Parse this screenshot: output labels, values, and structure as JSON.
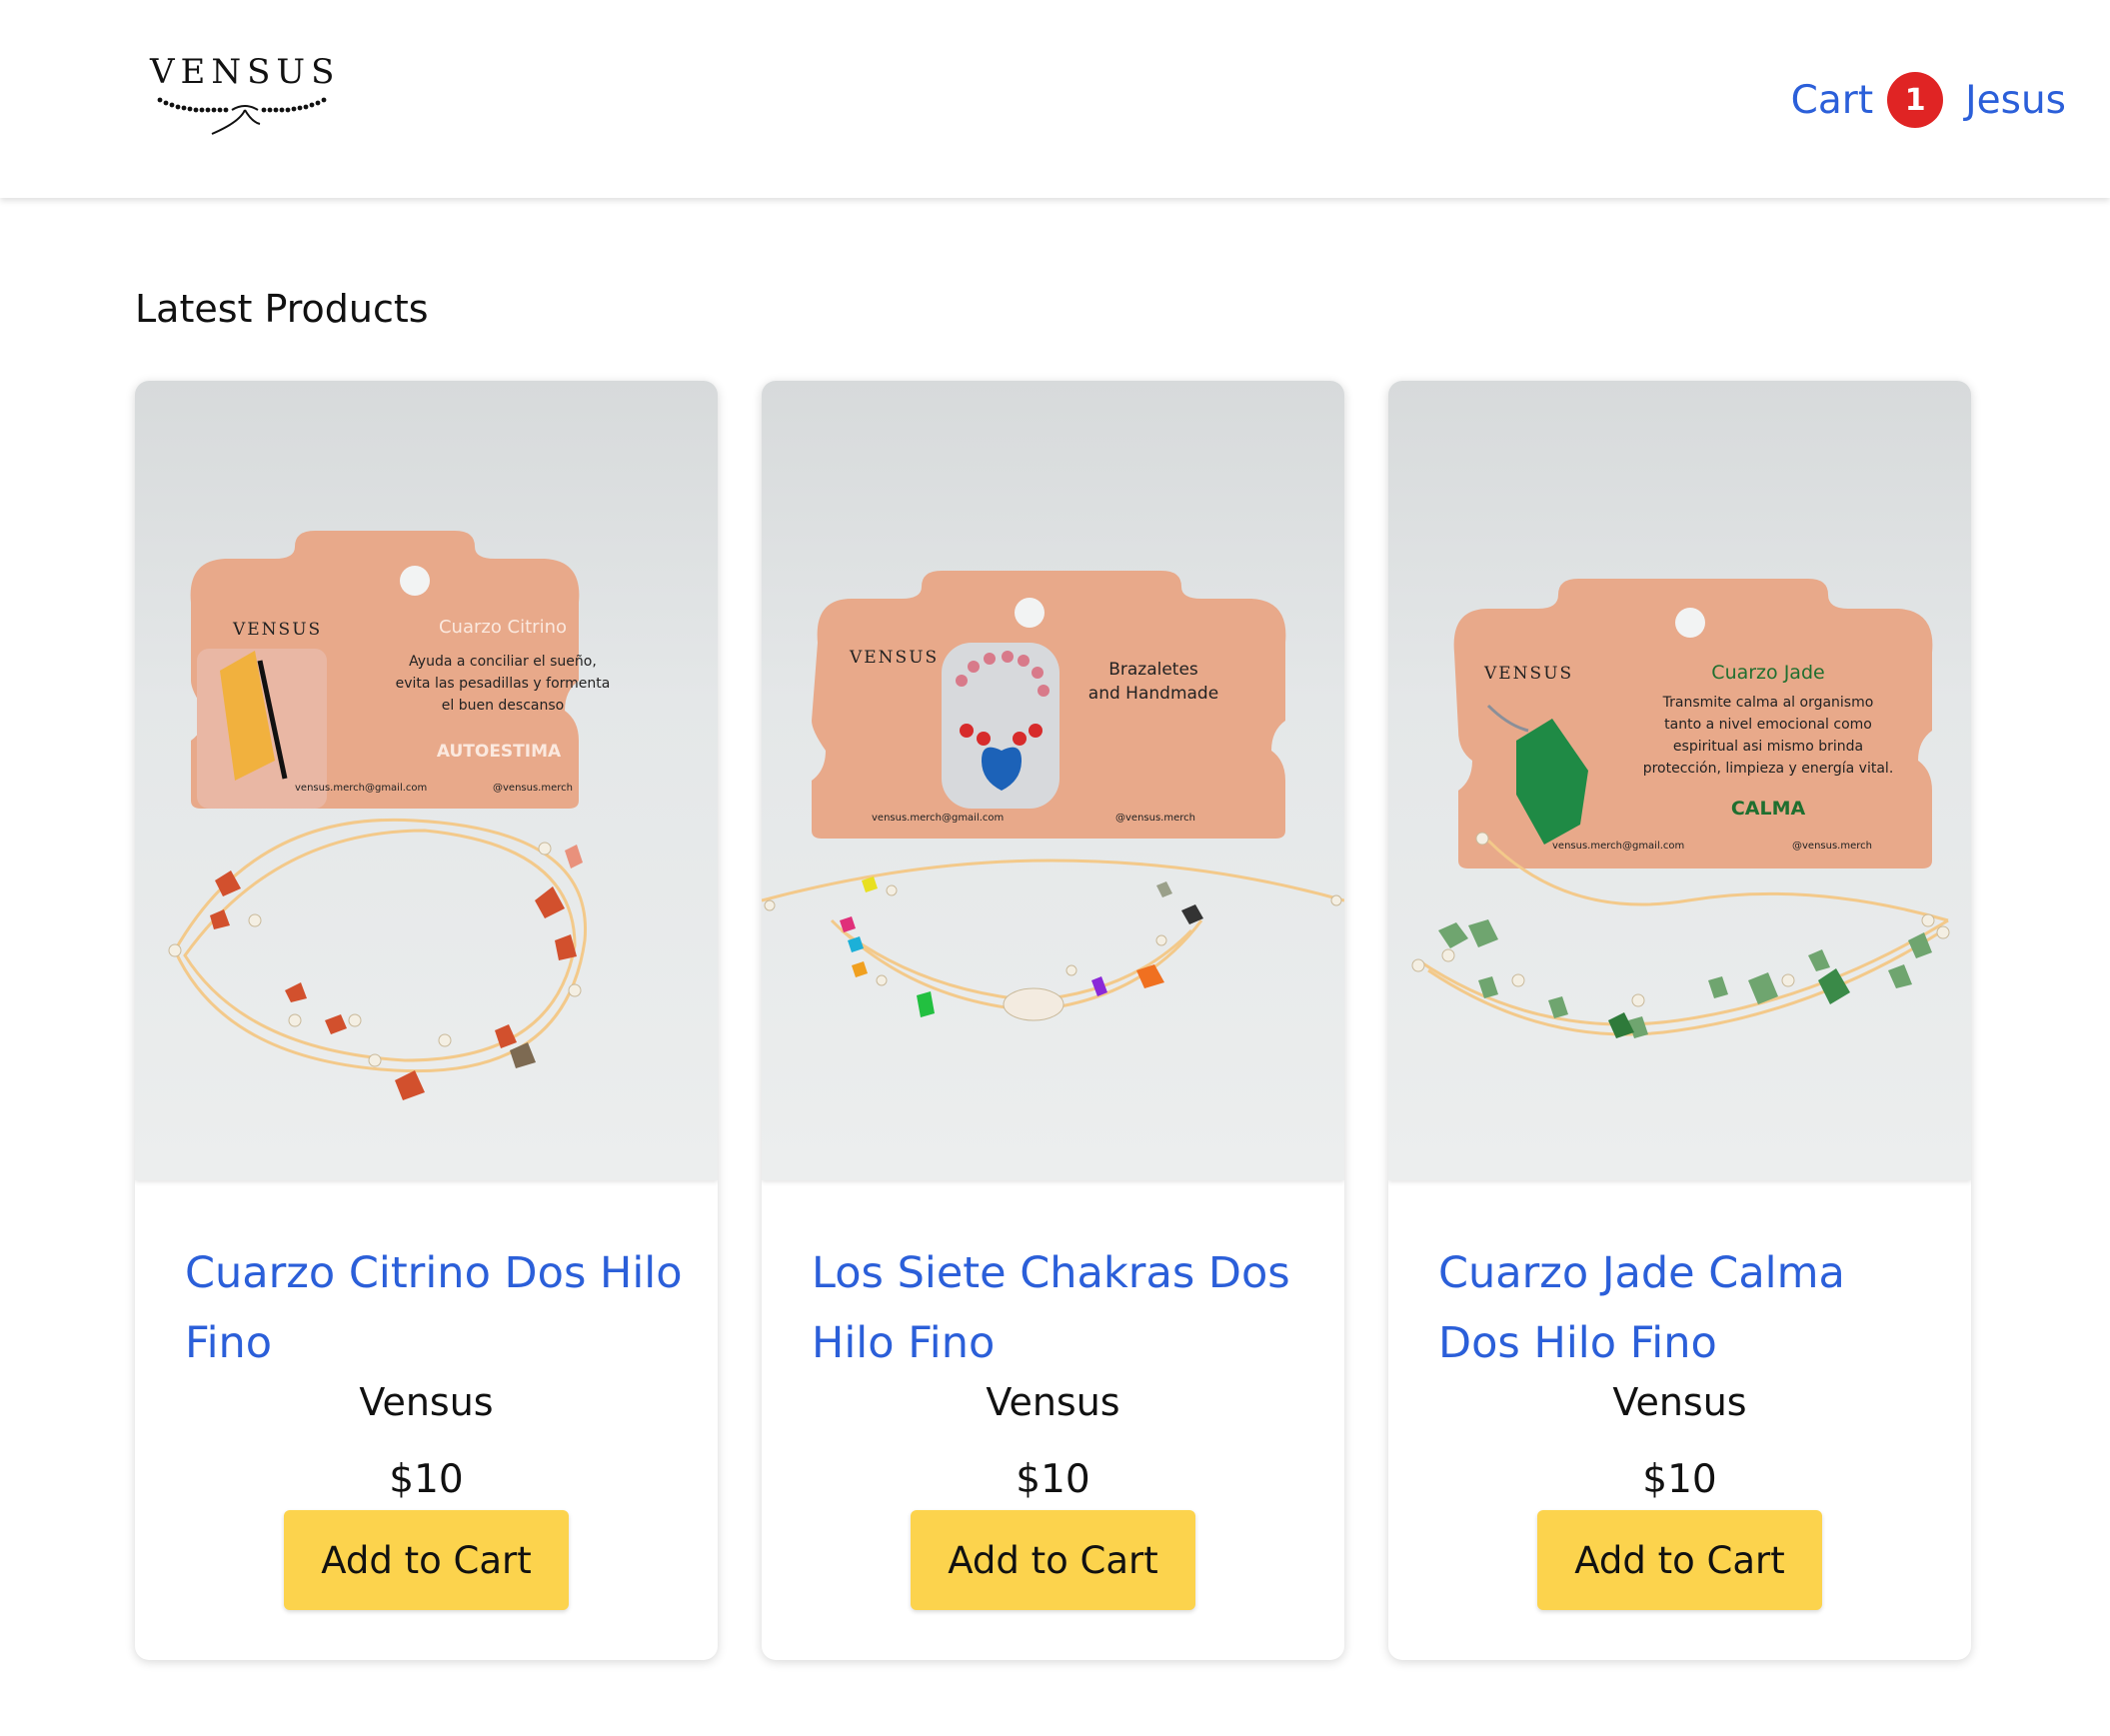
{
  "header": {
    "logo_text": "VENSUS",
    "nav": {
      "cart_label": "Cart",
      "cart_count": "1",
      "user_label": "Jesus"
    }
  },
  "main": {
    "section_title": "Latest Products",
    "products": [
      {
        "title": "Cuarzo Citrino Dos Hilo Fino",
        "brand": "Vensus",
        "price": "$10",
        "button_label": "Add to Cart",
        "image": {
          "card_logo": "VENSUS",
          "card_heading": "Cuarzo Citrino",
          "card_lines": [
            "Ayuda a conciliar el sueño,",
            "evita las pesadillas y formenta",
            "el buen descanso"
          ],
          "card_tag": "AUTOESTIMA",
          "card_email": "vensus.merch@gmail.com",
          "card_handle": "@vensus.merch"
        }
      },
      {
        "title": "Los Siete Chakras Dos Hilo Fino",
        "brand": "Vensus",
        "price": "$10",
        "button_label": "Add to Cart",
        "image": {
          "card_logo": "VENSUS",
          "card_heading": "Brazaletes",
          "card_lines": [
            "and Handmade"
          ],
          "card_tag": "",
          "card_email": "vensus.merch@gmail.com",
          "card_handle": "@vensus.merch"
        }
      },
      {
        "title": "Cuarzo Jade Calma Dos Hilo Fino",
        "brand": "Vensus",
        "price": "$10",
        "button_label": "Add to Cart",
        "image": {
          "card_logo": "VENSUS",
          "card_heading": "Cuarzo Jade",
          "card_lines": [
            "Transmite calma al organismo",
            "tanto a nivel emocional como",
            "espiritual asi mismo brinda",
            "protección, limpieza y energía vital."
          ],
          "card_tag": "CALMA",
          "card_email": "vensus.merch@gmail.com",
          "card_handle": "@vensus.merch"
        }
      }
    ]
  },
  "colors": {
    "link": "#2b5fd9",
    "badge": "#e02424",
    "button": "#fcd34d",
    "card_tan": "#e8a98a"
  }
}
